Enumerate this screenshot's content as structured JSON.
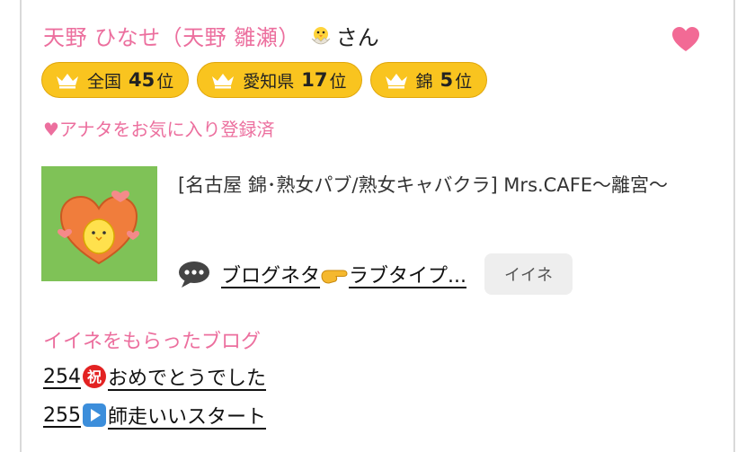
{
  "profile": {
    "name": "天野 ひなせ（天野 雛瀬）",
    "honorific": "さん"
  },
  "rankings": [
    {
      "area": "全国",
      "rank": "45",
      "suffix": "位"
    },
    {
      "area": "愛知県",
      "rank": "17",
      "suffix": "位"
    },
    {
      "area": "錦",
      "rank": "5",
      "suffix": "位"
    }
  ],
  "favorite_status": "♥アナタをお気に入り登録済",
  "blog": {
    "shop_title": "[名古屋 錦･熟女パブ/熟女キャバクラ]  Mrs.CAFE〜離宮〜",
    "post_prefix": "ブログネタ",
    "post_suffix": "ラブタイプ...",
    "iine_label": "イイネ"
  },
  "liked_blogs": {
    "heading": "イイネをもらったブログ",
    "items": [
      {
        "count": "254",
        "emoji_icon": "congratulations-icon",
        "title": "おめでとうでした"
      },
      {
        "count": "255",
        "emoji_icon": "play-button-icon",
        "title": "師走いいスタート"
      }
    ]
  },
  "colors": {
    "pink": "#ec6f9e",
    "badge_yellow": "#f9c41f",
    "heart": "#f26a95"
  }
}
